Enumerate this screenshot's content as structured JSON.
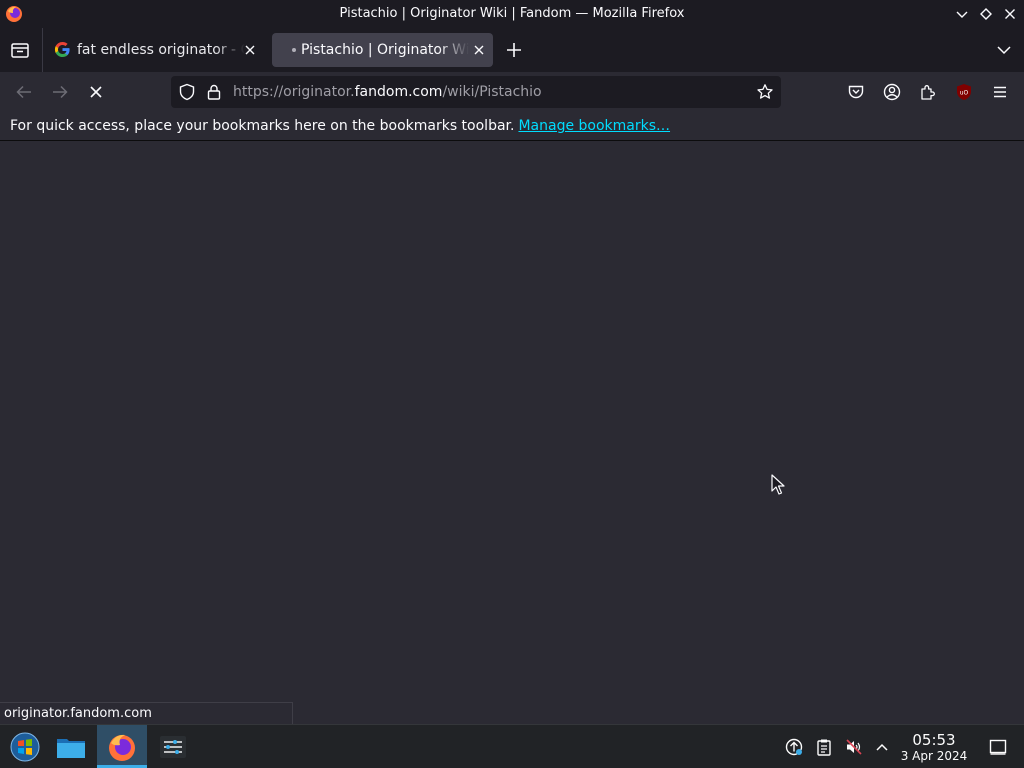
{
  "window": {
    "title": "Pistachio | Originator Wiki | Fandom — Mozilla Firefox"
  },
  "tabs": [
    {
      "label": "fat endless originator - Google Search",
      "favicon": "google-icon",
      "active": false
    },
    {
      "label": "Pistachio | Originator Wiki | Fandom",
      "favicon": "loading-dot",
      "active": true
    }
  ],
  "urlbar": {
    "url_prefix": "https://originator.",
    "url_host": "fandom.com",
    "url_path": "/wiki/Pistachio"
  },
  "bookmarks_toolbar": {
    "message": "For quick access, place your bookmarks here on the bookmarks toolbar.",
    "link": "Manage bookmarks…"
  },
  "status": {
    "text": "originator.fandom.com"
  },
  "taskbar": {
    "time": "05:53",
    "date": "3 Apr 2024"
  },
  "colors": {
    "accent_link": "#00ddff",
    "chrome_dark": "#1c1b22",
    "content_bg": "#2b2a33",
    "taskbar_active": "#3daee9"
  }
}
